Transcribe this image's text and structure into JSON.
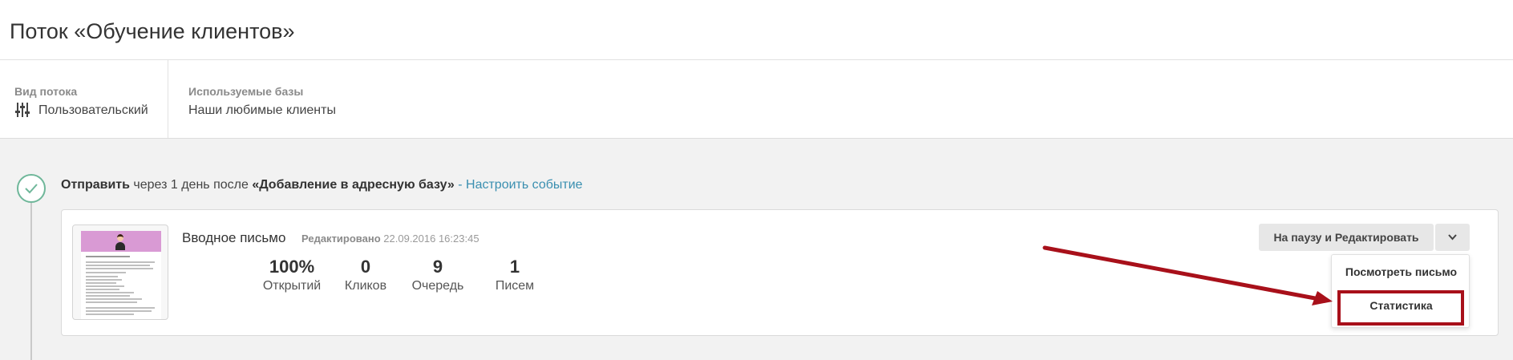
{
  "page": {
    "title": "Поток «Обучение клиентов»"
  },
  "info": {
    "flow_type_label": "Вид потока",
    "flow_type_value": "Пользовательский",
    "bases_label": "Используемые базы",
    "bases_value": "Наши любимые клиенты"
  },
  "event": {
    "action": "Отправить",
    "middle": " через 1 день после ",
    "trigger": "«Добавление в адресную базу»",
    "link_text": "- Настроить событие"
  },
  "letter": {
    "title": "Вводное письмо",
    "edited_label": "Редактировано",
    "edited_date": "22.09.2016 16:23:45",
    "stats": [
      {
        "value": "100%",
        "label": "Открытий"
      },
      {
        "value": "0",
        "label": "Кликов"
      },
      {
        "value": "9",
        "label": "Очередь"
      },
      {
        "value": "1",
        "label": "Писем"
      }
    ]
  },
  "actions": {
    "pause_edit_label": "На паузу и Редактировать",
    "menu": {
      "view_letter": "Посмотреть письмо",
      "statistics": "Статистика"
    }
  },
  "colors": {
    "accent_link": "#3a8fb0",
    "check_green": "#6fb79a",
    "annotation_red": "#a8101a",
    "background_gray": "#f2f2f2"
  },
  "icons": {
    "flow_type": "sliders-icon",
    "check": "check-circle-icon",
    "dropdown": "chevron-down-icon"
  }
}
